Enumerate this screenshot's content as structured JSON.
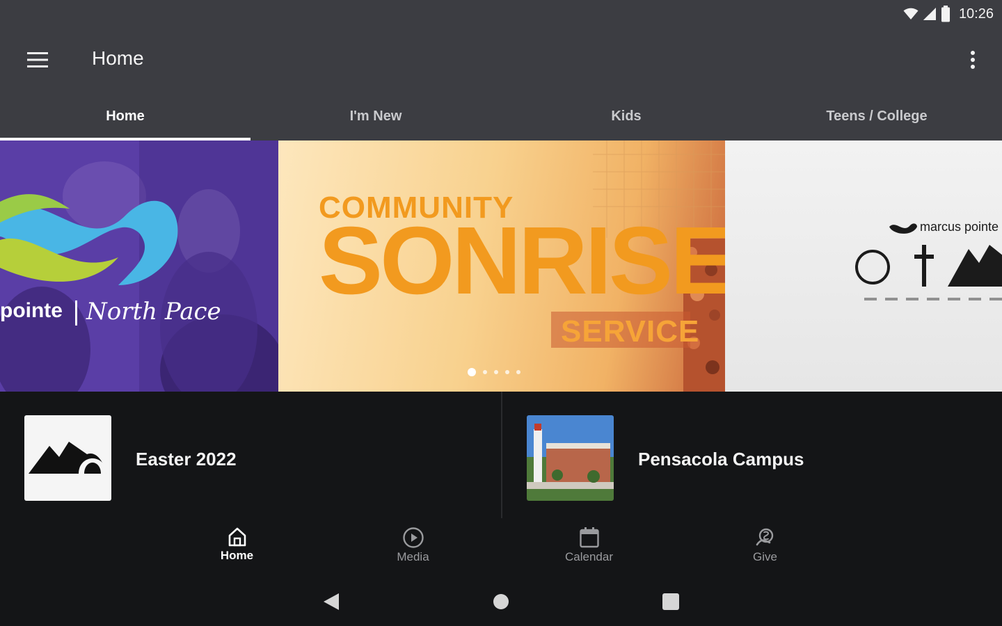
{
  "status_bar": {
    "time": "10:26"
  },
  "app_bar": {
    "title": "Home"
  },
  "tabs": [
    {
      "label": "Home",
      "active": true
    },
    {
      "label": "I'm New",
      "active": false
    },
    {
      "label": "Kids",
      "active": false
    },
    {
      "label": "Teens / College",
      "active": false
    }
  ],
  "carousel": {
    "left_slide": {
      "brand_text": "pointe",
      "campus_script": "North Pace"
    },
    "center_slide": {
      "line1": "COMMUNITY",
      "line2": "SONRISE",
      "line3": "SERVICE"
    },
    "right_slide": {
      "brand_text": "marcus pointe"
    },
    "dot_count": 5,
    "active_dot": 0
  },
  "cards": [
    {
      "title": "Easter 2022"
    },
    {
      "title": "Pensacola Campus"
    }
  ],
  "bottom_nav": [
    {
      "label": "Home",
      "icon": "home-icon",
      "active": true
    },
    {
      "label": "Media",
      "icon": "play-circle-icon",
      "active": false
    },
    {
      "label": "Calendar",
      "icon": "calendar-icon",
      "active": false
    },
    {
      "label": "Give",
      "icon": "give-hand-icon",
      "active": false
    }
  ],
  "colors": {
    "app_bar": "#3c3d42",
    "background": "#141517",
    "accent_orange": "#f29a1f",
    "inactive_text": "#9a9b9e"
  }
}
